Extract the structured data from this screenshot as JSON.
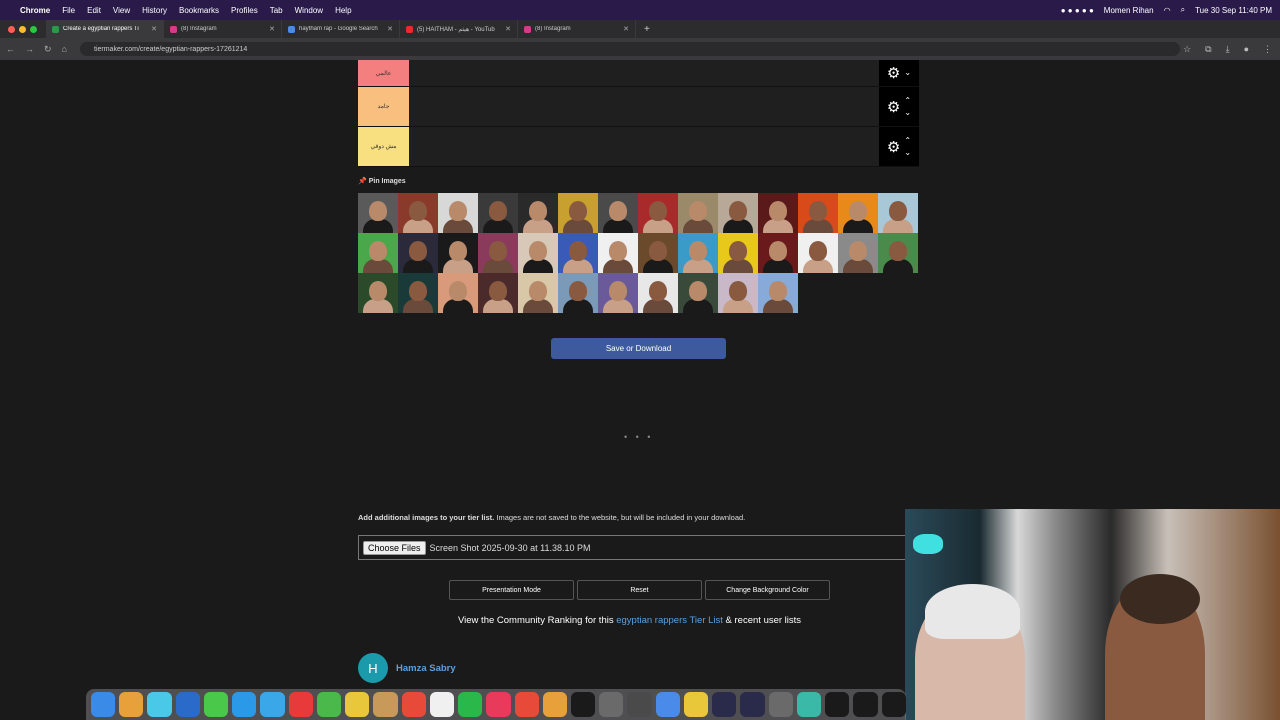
{
  "menubar": {
    "apple": "",
    "app": "Chrome",
    "menus": [
      "File",
      "Edit",
      "View",
      "History",
      "Bookmarks",
      "Profiles",
      "Tab",
      "Window",
      "Help"
    ],
    "user": "Momen Rihan",
    "datetime": "Tue 30 Sep  11:40 PM"
  },
  "tabs": [
    {
      "title": "Create a egyptian rappers Ti",
      "color": "#2a9a4a"
    },
    {
      "title": "(8) Instagram",
      "color": "#d83a8a"
    },
    {
      "title": "haytham rap - Google Search",
      "color": "#4a8ae8"
    },
    {
      "title": "(5) HAITHAM - هيثم - YouTub",
      "color": "#e82a2a"
    },
    {
      "title": "(8) Instagram",
      "color": "#d83a8a"
    }
  ],
  "address": {
    "url": "tiermaker.com/create/egyptian-rappers-17261214"
  },
  "tiers": [
    {
      "label": "عالمي",
      "color": "#f47f7f"
    },
    {
      "label": "جامد",
      "color": "#f8bf7f"
    },
    {
      "label": "مش دوقي",
      "color": "#f8df7f"
    }
  ],
  "pin": {
    "label": "Pin Images"
  },
  "images": [
    "#5a5a5a",
    "#8a3a2a",
    "#d8d8d8",
    "#3a3a3a",
    "#2a2a2a",
    "#c8a030",
    "#4a4a4a",
    "#a82a2a",
    "#9a8a6a",
    "#b8a898",
    "#5a1a1a",
    "#d84a1a",
    "#e88a1a",
    "#a8c8d8",
    "#4aa84a",
    "#2a2a3a",
    "#1a1a1a",
    "#8a3a5a",
    "#d8c8b8",
    "#3a5ab8",
    "#f0f0f0",
    "#6a4a2a",
    "#3a9ac8",
    "#e8c81a",
    "#6a1a1a",
    "#f0f0f0",
    "#8a8a8a",
    "#4a8a4a",
    "#2a4a2a",
    "#1a3a3a",
    "#d89a7a",
    "#4a2a2a",
    "#d8c8a8",
    "#7a9ab8",
    "#6a5a9a",
    "#e8e8e8",
    "#3a4a3a",
    "#c8b8c8",
    "#88aad8"
  ],
  "buttons": {
    "save": "Save or Download",
    "choose": "Choose Files",
    "presentation": "Presentation Mode",
    "reset": "Reset",
    "bgcolor": "Change Background Color"
  },
  "add": {
    "bold": "Add additional images to your tier list.",
    "rest": " Images are not saved to the website, but will be included in your download.",
    "file": "Screen Shot 2025-09-30 at 11.38.10 PM"
  },
  "community": {
    "pre": "View the Community Ranking for this ",
    "link": "egyptian rappers Tier List",
    "post": " & recent user lists"
  },
  "user": {
    "initial": "H",
    "name": "Hamza Sabry"
  },
  "dock": [
    "#3a8ae8",
    "#e8a03a",
    "#4ac8e8",
    "#2a6ac8",
    "#4ac84a",
    "#2a9ae8",
    "#3aa8e8",
    "#e83a3a",
    "#4ab84a",
    "#e8c83a",
    "#c89a5a",
    "#e84a3a",
    "#f0f0f0",
    "#2ab84a",
    "#e83a5a",
    "#e84a3a",
    "#e8a03a",
    "#1a1a1a",
    "#6a6a6a",
    "#4a4a4a",
    "#4a8ae8",
    "#e8c83a",
    "#2a2a4a",
    "#2a2a4a",
    "#6a6a6a",
    "#3ab8a8",
    "#1a1a1a",
    "#1a1a1a",
    "#1a1a1a"
  ]
}
